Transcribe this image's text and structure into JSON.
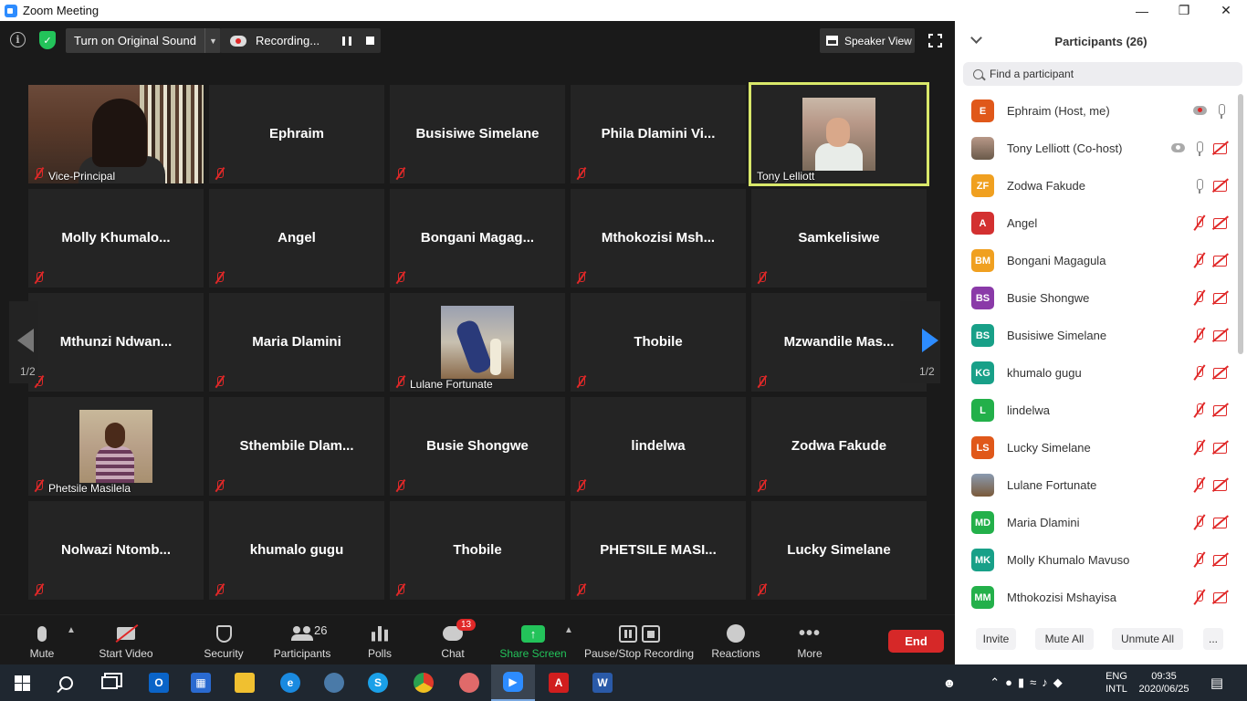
{
  "window": {
    "title": "Zoom Meeting"
  },
  "top_controls": {
    "original_sound_label": "Turn on Original Sound",
    "recording_label": "Recording...",
    "speaker_view_label": "Speaker View"
  },
  "grid": {
    "page_left": "1/2",
    "page_right": "1/2",
    "tiles": [
      {
        "name": "",
        "label": "Vice-Principal",
        "video": "vp"
      },
      {
        "name": "Ephraim",
        "label": ""
      },
      {
        "name": "Busisiwe Simelane",
        "label": ""
      },
      {
        "name": "Phila Dlamini Vi...",
        "label": ""
      },
      {
        "name": "",
        "label": "Tony Lelliott",
        "video": "tony",
        "active": true
      },
      {
        "name": "Molly  Khumalo...",
        "label": ""
      },
      {
        "name": "Angel",
        "label": ""
      },
      {
        "name": "Bongani  Magag...",
        "label": ""
      },
      {
        "name": "Mthokozisi  Msh...",
        "label": ""
      },
      {
        "name": "Samkelisiwe",
        "label": ""
      },
      {
        "name": "Mthunzi  Ndwan...",
        "label": ""
      },
      {
        "name": "Maria Dlamini",
        "label": ""
      },
      {
        "name": "",
        "label": "Lulane Fortunate",
        "video": "lulane"
      },
      {
        "name": "Thobile",
        "label": ""
      },
      {
        "name": "Mzwandile  Mas...",
        "label": ""
      },
      {
        "name": "",
        "label": "Phetsile Masilela",
        "video": "phetsile"
      },
      {
        "name": "Sthembile  Dlam...",
        "label": ""
      },
      {
        "name": "Busie Shongwe",
        "label": ""
      },
      {
        "name": "lindelwa",
        "label": ""
      },
      {
        "name": "Zodwa Fakude",
        "label": ""
      },
      {
        "name": "Nolwazi  Ntomb...",
        "label": ""
      },
      {
        "name": "khumalo gugu",
        "label": ""
      },
      {
        "name": "Thobile",
        "label": ""
      },
      {
        "name": "PHETSILE  MASI...",
        "label": ""
      },
      {
        "name": "Lucky Simelane",
        "label": ""
      }
    ]
  },
  "toolbar": {
    "mute": "Mute",
    "start_video": "Start Video",
    "security": "Security",
    "participants": "Participants",
    "participants_count": "26",
    "polls": "Polls",
    "chat": "Chat",
    "chat_badge": "13",
    "share_screen": "Share Screen",
    "pause_stop_recording": "Pause/Stop Recording",
    "reactions": "Reactions",
    "more": "More",
    "end": "End"
  },
  "participants_panel": {
    "title": "Participants (26)",
    "search_placeholder": "Find a participant",
    "people": [
      {
        "initials": "E",
        "name": "Ephraim (Host, me)",
        "color": "#e0581a",
        "icons": [
          "rec",
          "mic-on"
        ]
      },
      {
        "initials": "",
        "name": "Tony Lelliott (Co-host)",
        "color": "",
        "photo": true,
        "icons": [
          "rec-grey",
          "mic-on",
          "cam-off"
        ]
      },
      {
        "initials": "ZF",
        "name": "Zodwa Fakude",
        "color": "#f0a020",
        "icons": [
          "mic-on",
          "cam-off"
        ]
      },
      {
        "initials": "A",
        "name": "Angel",
        "color": "#d33030",
        "icons": [
          "mic-off",
          "cam-off"
        ]
      },
      {
        "initials": "BM",
        "name": "Bongani Magagula",
        "color": "#f0a020",
        "icons": [
          "mic-off",
          "cam-off"
        ]
      },
      {
        "initials": "BS",
        "name": "Busie Shongwe",
        "color": "#8a3aa8",
        "icons": [
          "mic-off",
          "cam-off"
        ]
      },
      {
        "initials": "BS",
        "name": "Busisiwe Simelane",
        "color": "#18a088",
        "icons": [
          "mic-off",
          "cam-off"
        ]
      },
      {
        "initials": "KG",
        "name": "khumalo gugu",
        "color": "#18a088",
        "icons": [
          "mic-off",
          "cam-off"
        ]
      },
      {
        "initials": "L",
        "name": "lindelwa",
        "color": "#23b04a",
        "icons": [
          "mic-off",
          "cam-off"
        ]
      },
      {
        "initials": "LS",
        "name": "Lucky Simelane",
        "color": "#e0581a",
        "icons": [
          "mic-off",
          "cam-off"
        ]
      },
      {
        "initials": "",
        "name": "Lulane Fortunate",
        "color": "",
        "photo2": true,
        "icons": [
          "mic-off",
          "cam-off"
        ]
      },
      {
        "initials": "MD",
        "name": "Maria Dlamini",
        "color": "#23b04a",
        "icons": [
          "mic-off",
          "cam-off"
        ]
      },
      {
        "initials": "MK",
        "name": "Molly Khumalo Mavuso",
        "color": "#18a088",
        "icons": [
          "mic-off",
          "cam-off"
        ]
      },
      {
        "initials": "MM",
        "name": "Mthokozisi Mshayisa",
        "color": "#23b04a",
        "icons": [
          "mic-off",
          "cam-off"
        ]
      }
    ],
    "footer": {
      "invite": "Invite",
      "mute_all": "Mute All",
      "unmute_all": "Unmute All",
      "more": "..."
    }
  },
  "taskbar": {
    "lang_line1": "ENG",
    "lang_line2": "INTL",
    "time": "09:35",
    "date": "2020/06/25"
  }
}
